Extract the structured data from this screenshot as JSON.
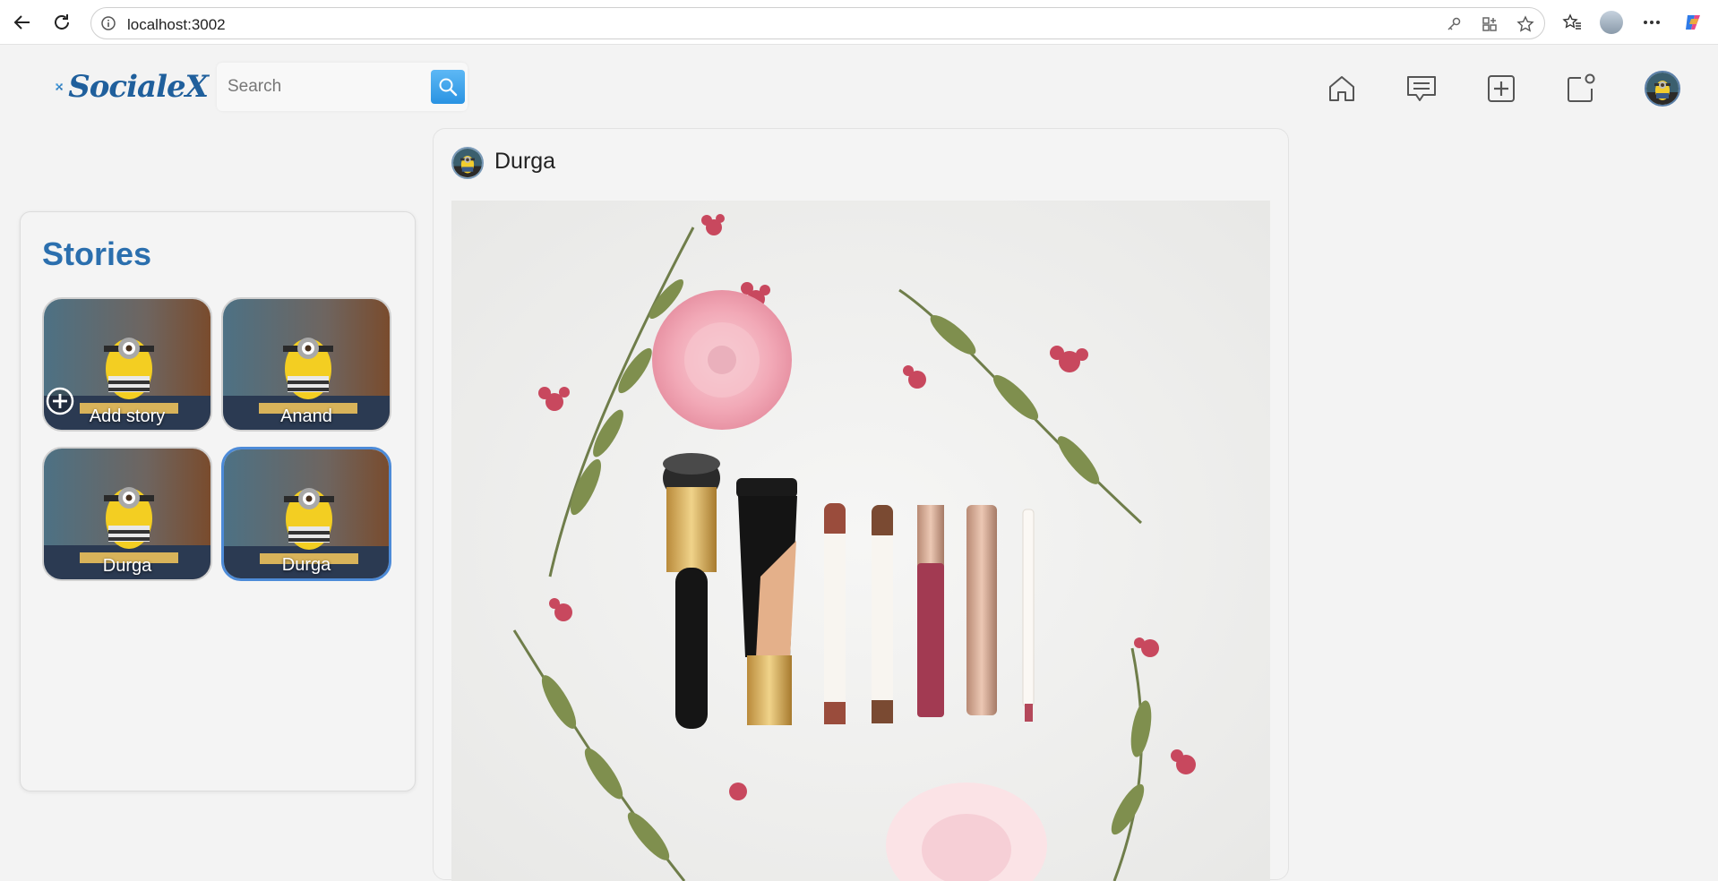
{
  "browser": {
    "url": "localhost:3002"
  },
  "app": {
    "logo_text": "SocialeX",
    "search": {
      "placeholder": "Search",
      "value": ""
    }
  },
  "topnav": {
    "icons": [
      "home-icon",
      "chat-icon",
      "add-post-icon",
      "notifications-icon"
    ]
  },
  "stories": {
    "title": "Stories",
    "items": [
      {
        "label": "Add story",
        "is_add": true
      },
      {
        "label": "Anand"
      },
      {
        "label": "Durga"
      },
      {
        "label": "Durga",
        "active": true
      }
    ]
  },
  "post": {
    "username": "Durga"
  },
  "colors": {
    "accent": "#2b6fae",
    "search_button": "#2a93e2",
    "story_active_border": "#4d8bd8"
  }
}
